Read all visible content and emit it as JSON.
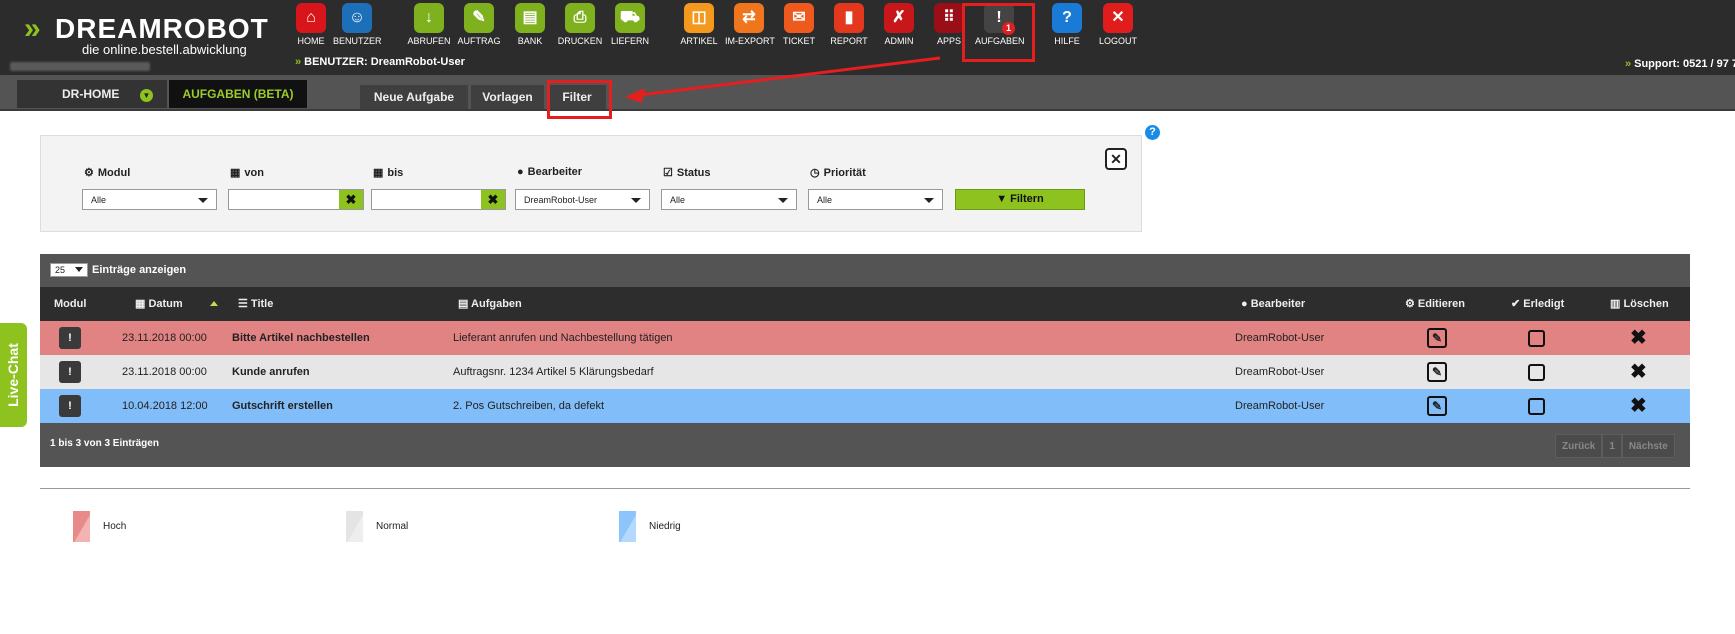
{
  "brand": {
    "name": "DREAMROBOT",
    "tagline": "die online.bestell.abwicklung"
  },
  "nav": [
    {
      "label": "HOME",
      "icon": "home-icon",
      "color": "#d8151b",
      "glyph": "⌂"
    },
    {
      "label": "BENUTZER",
      "icon": "user-icon",
      "color": "#1d6fb8",
      "glyph": "☺"
    },
    {
      "label": "ABRUFEN",
      "icon": "download-icon",
      "color": "#7fb11f",
      "glyph": "↓"
    },
    {
      "label": "AUFTRAG",
      "icon": "order-icon",
      "color": "#7fb11f",
      "glyph": "✎"
    },
    {
      "label": "BANK",
      "icon": "bank-icon",
      "color": "#7fb11f",
      "glyph": "▤"
    },
    {
      "label": "DRUCKEN",
      "icon": "print-icon",
      "color": "#7fb11f",
      "glyph": "⎙"
    },
    {
      "label": "LIEFERN",
      "icon": "delivery-icon",
      "color": "#7fb11f",
      "glyph": "⛟"
    },
    {
      "label": "ARTIKEL",
      "icon": "article-icon",
      "color": "#f39a1e",
      "glyph": "◫"
    },
    {
      "label": "IM-EXPORT",
      "icon": "import-export-icon",
      "color": "#f0761e",
      "glyph": "⇄"
    },
    {
      "label": "TICKET",
      "icon": "ticket-icon",
      "color": "#ee5a1e",
      "glyph": "✉"
    },
    {
      "label": "REPORT",
      "icon": "report-icon",
      "color": "#e3371e",
      "glyph": "▮"
    },
    {
      "label": "ADMIN",
      "icon": "admin-icon",
      "color": "#c8171b",
      "glyph": "✗"
    },
    {
      "label": "APPS",
      "icon": "apps-icon",
      "color": "#9a0f17",
      "glyph": "⠿"
    },
    {
      "label": "AUFGABEN",
      "icon": "tasks-icon",
      "color": "#444444",
      "glyph": "!",
      "badge": "1"
    },
    {
      "label": "HILFE",
      "icon": "help-icon",
      "color": "#1a7bd6",
      "glyph": "?"
    },
    {
      "label": "LOGOUT",
      "icon": "logout-icon",
      "color": "#e01c1c",
      "glyph": "✕"
    }
  ],
  "user_line": "BENUTZER: DreamRobot-User",
  "support": "Support: 0521 / 97 7",
  "subnav": {
    "home": "DR-HOME",
    "current_tab": "AUFGABEN (BETA)",
    "tabs": [
      "Neue Aufgabe",
      "Vorlagen",
      "Filter"
    ]
  },
  "filter": {
    "labels": {
      "modul": "Modul",
      "von": "von",
      "bis": "bis",
      "bearbeiter": "Bearbeiter",
      "status": "Status",
      "prioritaet": "Priorität"
    },
    "values": {
      "modul": "Alle",
      "bearbeiter": "DreamRobot-User",
      "status": "Alle",
      "prioritaet": "Alle",
      "von": "",
      "bis": ""
    },
    "button": "Filtern"
  },
  "table": {
    "page_size": "25",
    "page_size_label": "Einträge anzeigen",
    "columns": [
      "Modul",
      "Datum",
      "Title",
      "Aufgaben",
      "Bearbeiter",
      "Editieren",
      "Erledigt",
      "Löschen"
    ],
    "rows": [
      {
        "datum": "23.11.2018 00:00",
        "title": "Bitte Artikel nachbestellen",
        "aufgabe": "Lieferant anrufen und Nachbestellung tätigen",
        "bearbeiter": "DreamRobot-User",
        "priority": "hoch",
        "color": "#e28383"
      },
      {
        "datum": "23.11.2018 00:00",
        "title": "Kunde anrufen",
        "aufgabe": "Auftragsnr. 1234 Artikel 5 Klärungsbedarf",
        "bearbeiter": "DreamRobot-User",
        "priority": "normal",
        "color": "#e6e6e6"
      },
      {
        "datum": "10.04.2018 12:00",
        "title": "Gutschrift erstellen",
        "aufgabe": "2. Pos Gutschreiben, da defekt",
        "bearbeiter": "DreamRobot-User",
        "priority": "niedrig",
        "color": "#81bdf8"
      }
    ],
    "info": "1 bis 3 von 3 Einträgen",
    "pager": {
      "prev": "Zurück",
      "page": "1",
      "next": "Nächste"
    }
  },
  "legend": [
    {
      "label": "Hoch",
      "color": "#e98a8a"
    },
    {
      "label": "Normal",
      "color": "#e4e4e4"
    },
    {
      "label": "Niedrig",
      "color": "#8cc4fb"
    }
  ],
  "livechat": "Live-Chat"
}
